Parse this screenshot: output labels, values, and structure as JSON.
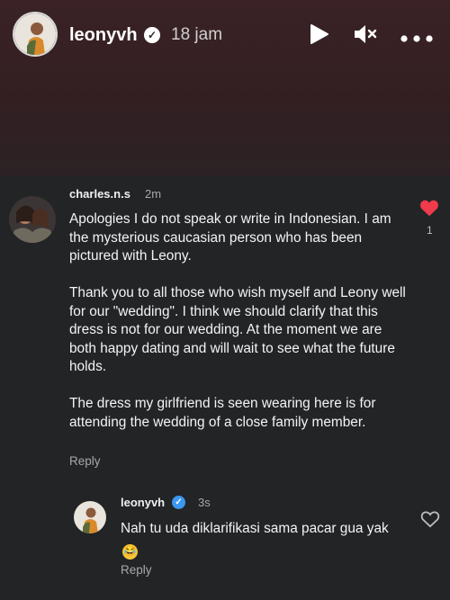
{
  "story": {
    "username": "leonyvh",
    "time": "18 jam",
    "icons": [
      "play-icon",
      "mute-icon",
      "more-icon",
      "verified-icon"
    ]
  },
  "comment": {
    "username": "charles.n.s",
    "time": "2m",
    "paragraphs": [
      "Apologies I do not speak or write in Indonesian. I am the mysterious caucasian person who has been pictured with Leony.",
      "Thank you to all those who wish myself and Leony well for our \"wedding\". I think we should clarify that this dress is not for our wedding. At the moment we are both happy dating and will wait to see what the future holds.",
      "The dress my girlfriend is seen wearing here is for attending the wedding of a close family member."
    ],
    "reply_label": "Reply",
    "like_count": "1",
    "like_color": "#ef3b4b"
  },
  "reply": {
    "username": "leonyvh",
    "time": "3s",
    "text": "Nah tu uda diklarifikasi sama pacar gua yak",
    "emoji": "rolling-on-floor-laughing-emoji",
    "reply_label": "Reply"
  }
}
